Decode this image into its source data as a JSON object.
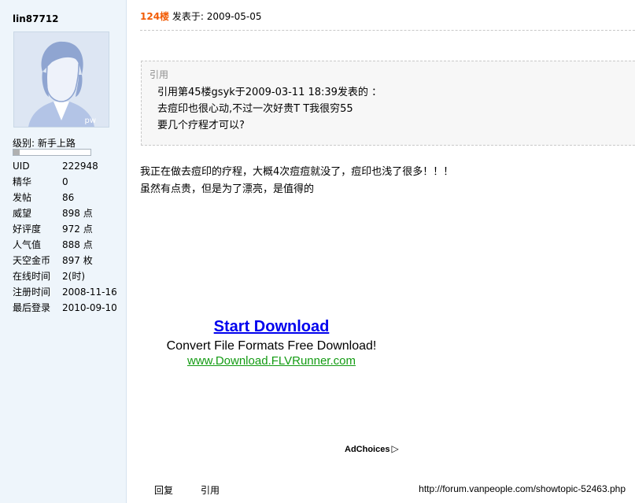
{
  "user": {
    "name": "lin87712",
    "avatar_badge": "pw",
    "level_label": "级别: 新手上路",
    "level_progress": 0.08,
    "stats": [
      {
        "key": "UID",
        "value": "222948"
      },
      {
        "key": "精华",
        "value": "0"
      },
      {
        "key": "发帖",
        "value": "86"
      },
      {
        "key": "威望",
        "value": "898 点"
      },
      {
        "key": "好评度",
        "value": "972 点"
      },
      {
        "key": "人气值",
        "value": "888 点"
      },
      {
        "key": "天空金币",
        "value": "897 枚"
      },
      {
        "key": "在线时间",
        "value": "2(时)"
      },
      {
        "key": "注册时间",
        "value": "2008-11-16"
      },
      {
        "key": "最后登录",
        "value": "2010-09-10"
      }
    ]
  },
  "post": {
    "floor": "124楼",
    "posted_at": " 发表于: 2009-05-05",
    "quote": {
      "title": "引用",
      "lines": [
        "引用第45楼gsyk于2009-03-11 18:39发表的 ：",
        "去痘印也很心动,不过一次好贵T T我很穷55",
        "要几个疗程才可以?"
      ]
    },
    "body": [
      "我正在做去痘印的疗程，大概4次痘痘就没了，痘印也浅了很多！！！",
      "虽然有点贵，但是为了漂亮，是值得的"
    ]
  },
  "ad": {
    "title": "Start Download",
    "description": "Convert File Formats Free Download!",
    "url": "www.Download.FLVRunner.com",
    "adchoices": "AdChoices",
    "adchoices_icon": "▷"
  },
  "actions": {
    "reply": "回复",
    "quote": "引用"
  },
  "status_url": "http://forum.vanpeople.com/showtopic-52463.php"
}
